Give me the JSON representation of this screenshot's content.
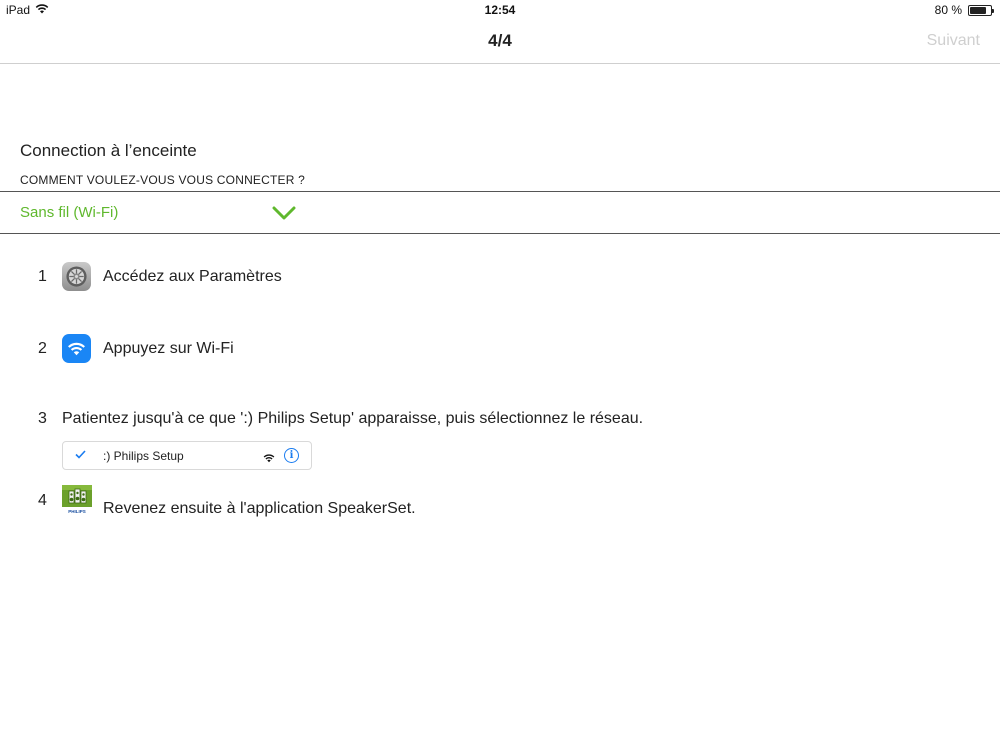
{
  "status_bar": {
    "device": "iPad",
    "time": "12:54",
    "battery_text": "80 %",
    "battery_level": 0.8
  },
  "nav": {
    "title": "4/4",
    "next_label": "Suivant"
  },
  "section": {
    "title": "Connection à l’enceinte",
    "subtitle": "COMMENT VOULEZ-VOUS VOUS CONNECTER ?"
  },
  "connection_select": {
    "value": "Sans fil (Wi-Fi)",
    "accent_color": "#5fb82d"
  },
  "steps": [
    {
      "number": "1",
      "text": "Accédez aux Paramètres",
      "icon": "settings-icon"
    },
    {
      "number": "2",
      "text": "Appuyez sur Wi-Fi",
      "icon": "wifi-icon"
    },
    {
      "number": "3",
      "text": "Patientez jusqu'à ce que ':) Philips Setup' apparaisse, puis sélectionnez le réseau."
    },
    {
      "number": "4",
      "text": "Revenez ensuite à l'application SpeakerSet.",
      "icon": "speakerset-app-icon"
    }
  ],
  "wifi_network": {
    "name": ":) Philips Setup",
    "info_glyph": "i"
  },
  "app_icon": {
    "brand": "PHILIPS"
  }
}
